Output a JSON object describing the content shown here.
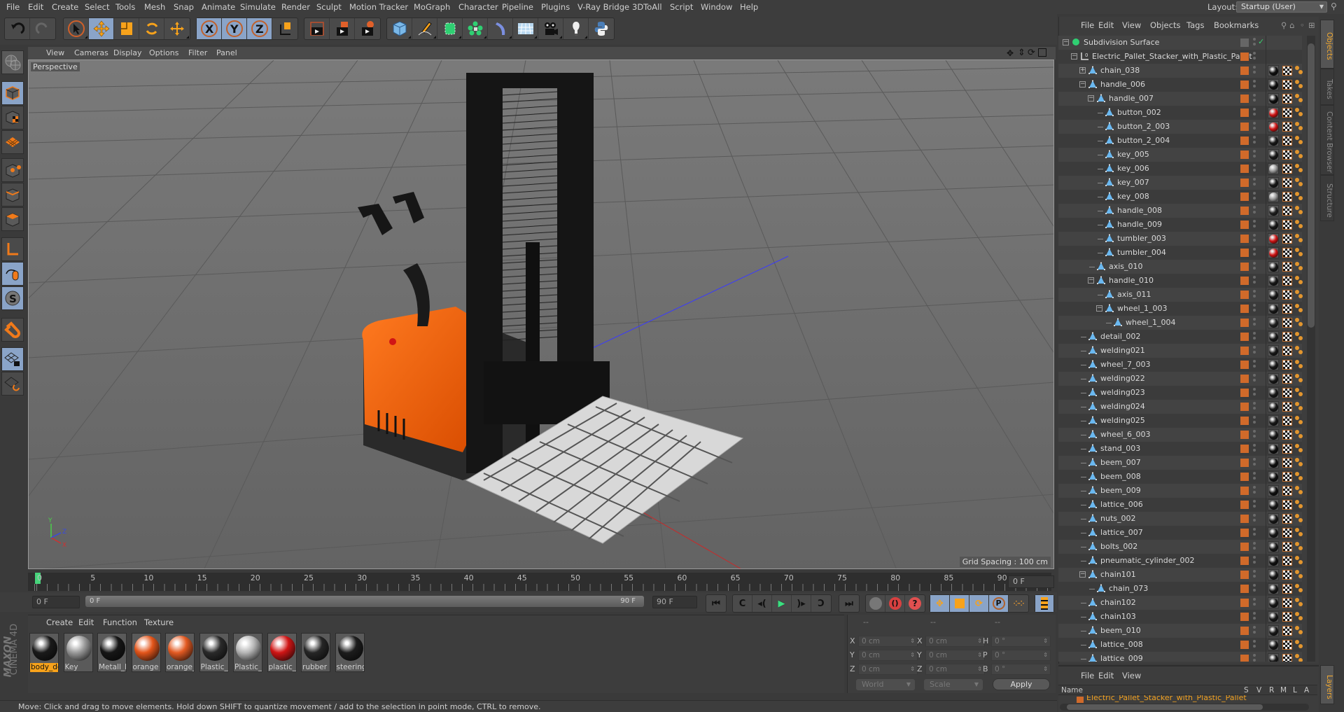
{
  "menubar": {
    "items": [
      "File",
      "Edit",
      "Create",
      "Select",
      "Tools",
      "Mesh",
      "Snap",
      "Animate",
      "Simulate",
      "Render",
      "Sculpt",
      "Motion Tracker",
      "MoGraph",
      "Character",
      "Pipeline",
      "Plugins",
      "V-Ray Bridge",
      "3DToAll",
      "Script",
      "Window",
      "Help"
    ],
    "layout_label": "Layout:",
    "layout_value": "Startup (User)"
  },
  "toolbar": {
    "groups": [
      [
        "undo-icon",
        "redo-icon"
      ],
      [
        "live-selection-icon",
        "move-icon",
        "scale-icon",
        "rotate-icon",
        "last-tool-icon"
      ],
      [
        "x-axis-lock-icon",
        "y-axis-lock-icon",
        "z-axis-lock-icon",
        "coordinate-system-icon"
      ],
      [
        "render-view-icon",
        "render-to-picture-viewer-icon",
        "render-settings-icon"
      ],
      [
        "cube-icon",
        "pen-spline-icon",
        "subdivision-surface-icon",
        "cloner-icon",
        "deformer-icon",
        "floor-icon",
        "camera-icon",
        "light-icon",
        "python-icon"
      ]
    ],
    "active": [
      "move-icon",
      "x-axis-lock-icon",
      "y-axis-lock-icon",
      "z-axis-lock-icon"
    ]
  },
  "left_tools": [
    "make-editable-icon",
    "model-mode-icon",
    "texture-mode-icon",
    "workplane-mode-icon",
    "points-mode-icon",
    "edges-mode-icon",
    "polygons-mode-icon",
    "axis-mode-icon",
    "tweak-mode-icon",
    "solo-mode-icon",
    "snap-icon",
    "workplane-lock-icon",
    "workplane-align-icon"
  ],
  "viewport": {
    "menu": [
      "View",
      "Cameras",
      "Display",
      "Options",
      "Filter",
      "Panel"
    ],
    "camera_label": "Perspective",
    "grid_spacing": "Grid Spacing : 100 cm",
    "nav_icons": [
      "move-view-icon",
      "zoom-view-icon",
      "rotate-view-icon",
      "maximize-view-icon"
    ],
    "axis": {
      "x": "X",
      "y": "Y",
      "z": "Z"
    }
  },
  "timeline": {
    "ticks": [
      "0",
      "5",
      "10",
      "15",
      "20",
      "25",
      "30",
      "35",
      "40",
      "45",
      "50",
      "55",
      "60",
      "65",
      "70",
      "75",
      "80",
      "85",
      "90"
    ],
    "current_frame": "0 F",
    "start_field": "0 F",
    "range_start": "0 F",
    "range_end": "90 F",
    "end_field": "90 F"
  },
  "playback": {
    "buttons": [
      "go-to-start-icon",
      "previous-key-icon",
      "previous-frame-icon",
      "play-icon",
      "next-frame-icon",
      "next-key-icon",
      "go-to-end-icon"
    ],
    "record_buttons": [
      "record-keys-icon",
      "autokey-icon",
      "keyframe-selection-icon"
    ],
    "key_buttons": [
      "key-position-icon",
      "key-scale-icon",
      "key-rotation-icon",
      "key-parameter-icon",
      "key-pla-icon"
    ],
    "timeline_icon": "timeline-icon"
  },
  "materials": {
    "menu": [
      "Create",
      "Edit",
      "Function",
      "Texture"
    ],
    "items": [
      {
        "name": "body_dc",
        "color": "#1a1a1a",
        "selected": true
      },
      {
        "name": "Key",
        "color": "#9a9a9a",
        "selected": false
      },
      {
        "name": "Metall_b",
        "color": "#161616",
        "selected": false
      },
      {
        "name": "orange",
        "color": "#e3551a",
        "selected": false
      },
      {
        "name": "orange_",
        "color": "#e35a22",
        "selected": false
      },
      {
        "name": "Plastic_b",
        "color": "#2a2a2a",
        "selected": false
      },
      {
        "name": "Plastic_p",
        "color": "#b5b5b5",
        "selected": false
      },
      {
        "name": "plastic_r",
        "color": "#d01515",
        "selected": false
      },
      {
        "name": "rubber",
        "color": "#262626",
        "selected": false
      },
      {
        "name": "steering",
        "color": "#1c1c1c",
        "selected": false
      }
    ],
    "brand_top": "MAXON",
    "brand_bottom": "CINEMA 4D"
  },
  "coordinates": {
    "headers": [
      "--",
      "--",
      "--"
    ],
    "rows": [
      {
        "l1": "X",
        "v1": "0 cm",
        "l2": "X",
        "v2": "0 cm",
        "l3": "H",
        "v3": "0 °"
      },
      {
        "l1": "Y",
        "v1": "0 cm",
        "l2": "Y",
        "v2": "0 cm",
        "l3": "P",
        "v3": "0 °"
      },
      {
        "l1": "Z",
        "v1": "0 cm",
        "l2": "Z",
        "v2": "0 cm",
        "l3": "B",
        "v3": "0 °"
      }
    ],
    "mode": "World",
    "type": "Scale",
    "apply_label": "Apply"
  },
  "status": "Move: Click and drag to move elements. Hold down SHIFT to quantize movement / add to the selection in point mode, CTRL to remove.",
  "object_manager": {
    "menu": [
      "File",
      "Edit",
      "View",
      "Objects",
      "Tags",
      "Bookmarks"
    ],
    "objects": [
      {
        "name": "Subdivision Surface",
        "depth": 0,
        "type": "subdiv",
        "expand": "minus"
      },
      {
        "name": "Electric_Pallet_Stacker_with_Plastic_Pallet",
        "depth": 1,
        "type": "null",
        "expand": "minus"
      },
      {
        "name": "chain_038",
        "depth": 2,
        "type": "poly",
        "expand": "plus",
        "mat": "#111111"
      },
      {
        "name": "handle_006",
        "depth": 2,
        "type": "poly",
        "expand": "minus",
        "mat": "#111111"
      },
      {
        "name": "handle_007",
        "depth": 3,
        "type": "poly",
        "expand": "minus",
        "mat": "#111111"
      },
      {
        "name": "button_002",
        "depth": 4,
        "type": "poly",
        "mat": "#d01515"
      },
      {
        "name": "button_2_003",
        "depth": 4,
        "type": "poly",
        "mat": "#d01515"
      },
      {
        "name": "button_2_004",
        "depth": 4,
        "type": "poly",
        "mat": "#1a1a1a"
      },
      {
        "name": "key_005",
        "depth": 4,
        "type": "poly",
        "mat": "#1a1a1a"
      },
      {
        "name": "key_006",
        "depth": 4,
        "type": "poly",
        "mat": "#9a9a9a"
      },
      {
        "name": "key_007",
        "depth": 4,
        "type": "poly",
        "mat": "#1a1a1a"
      },
      {
        "name": "key_008",
        "depth": 4,
        "type": "poly",
        "mat": "#9a9a9a"
      },
      {
        "name": "handle_008",
        "depth": 4,
        "type": "poly",
        "mat": "#222222"
      },
      {
        "name": "handle_009",
        "depth": 4,
        "type": "poly",
        "mat": "#1a1a1a"
      },
      {
        "name": "tumbler_003",
        "depth": 4,
        "type": "poly",
        "mat": "#d01515"
      },
      {
        "name": "tumbler_004",
        "depth": 4,
        "type": "poly",
        "mat": "#d01515"
      },
      {
        "name": "axis_010",
        "depth": 3,
        "type": "poly",
        "mat": "#1a1a1a"
      },
      {
        "name": "handle_010",
        "depth": 3,
        "type": "poly",
        "expand": "minus",
        "mat": "#1a1a1a"
      },
      {
        "name": "axis_011",
        "depth": 4,
        "type": "poly",
        "mat": "#1a1a1a"
      },
      {
        "name": "wheel_1_003",
        "depth": 4,
        "type": "poly",
        "expand": "minus",
        "mat": "#1a1a1a"
      },
      {
        "name": "wheel_1_004",
        "depth": 5,
        "type": "poly",
        "mat": "#222222"
      },
      {
        "name": "detail_002",
        "depth": 2,
        "type": "poly",
        "mat": "#1a1a1a"
      },
      {
        "name": "welding021",
        "depth": 2,
        "type": "poly",
        "mat": "#1a1a1a"
      },
      {
        "name": "wheel_7_003",
        "depth": 2,
        "type": "poly",
        "mat": "#1a1a1a"
      },
      {
        "name": "welding022",
        "depth": 2,
        "type": "poly",
        "mat": "#1a1a1a"
      },
      {
        "name": "welding023",
        "depth": 2,
        "type": "poly",
        "mat": "#1a1a1a"
      },
      {
        "name": "welding024",
        "depth": 2,
        "type": "poly",
        "mat": "#1a1a1a"
      },
      {
        "name": "welding025",
        "depth": 2,
        "type": "poly",
        "mat": "#1a1a1a"
      },
      {
        "name": "wheel_6_003",
        "depth": 2,
        "type": "poly",
        "mat": "#1a1a1a"
      },
      {
        "name": "stand_003",
        "depth": 2,
        "type": "poly",
        "mat": "#111111"
      },
      {
        "name": "beem_007",
        "depth": 2,
        "type": "poly",
        "mat": "#111111"
      },
      {
        "name": "beem_008",
        "depth": 2,
        "type": "poly",
        "mat": "#111111"
      },
      {
        "name": "beem_009",
        "depth": 2,
        "type": "poly",
        "mat": "#111111"
      },
      {
        "name": "lattice_006",
        "depth": 2,
        "type": "poly",
        "mat": "#1a1a1a"
      },
      {
        "name": "nuts_002",
        "depth": 2,
        "type": "poly",
        "mat": "#1a1a1a"
      },
      {
        "name": "lattice_007",
        "depth": 2,
        "type": "poly",
        "mat": "#1a1a1a"
      },
      {
        "name": "bolts_002",
        "depth": 2,
        "type": "poly",
        "mat": "#1a1a1a"
      },
      {
        "name": "pneumatic_cylinder_002",
        "depth": 2,
        "type": "poly",
        "mat": "#111111"
      },
      {
        "name": "chain101",
        "depth": 2,
        "type": "poly",
        "expand": "minus",
        "mat": "#1a1a1a"
      },
      {
        "name": "chain_073",
        "depth": 3,
        "type": "poly",
        "mat": "#1a1a1a"
      },
      {
        "name": "chain102",
        "depth": 2,
        "type": "poly",
        "mat": "#1a1a1a"
      },
      {
        "name": "chain103",
        "depth": 2,
        "type": "poly",
        "mat": "#1a1a1a"
      },
      {
        "name": "beem_010",
        "depth": 2,
        "type": "poly",
        "mat": "#1a1a1a"
      },
      {
        "name": "lattice_008",
        "depth": 2,
        "type": "poly",
        "mat": "#1a1a1a"
      },
      {
        "name": "lattice_009",
        "depth": 2,
        "type": "poly",
        "mat": "#1a1a1a"
      }
    ]
  },
  "side_tabs": [
    {
      "label": "Objects",
      "active": true
    },
    {
      "label": "Takes",
      "active": false
    },
    {
      "label": "Content Browser",
      "active": false
    },
    {
      "label": "Structure",
      "active": false
    }
  ],
  "layers_tab": "Layers",
  "layer_manager": {
    "menu": [
      "File",
      "Edit",
      "View"
    ],
    "columns": [
      "Name",
      "S",
      "V",
      "R",
      "M",
      "L",
      "A"
    ],
    "rows": [
      {
        "name": "Electric_Pallet_Stacker_with_Plastic_Pallet",
        "color": "#d06a2a"
      }
    ]
  },
  "colors": {
    "accent": "#f7a21b",
    "tag_orange": "#d06a2a",
    "active_tool": "#8aa4c8",
    "timeline_marker": "#46d37a"
  }
}
